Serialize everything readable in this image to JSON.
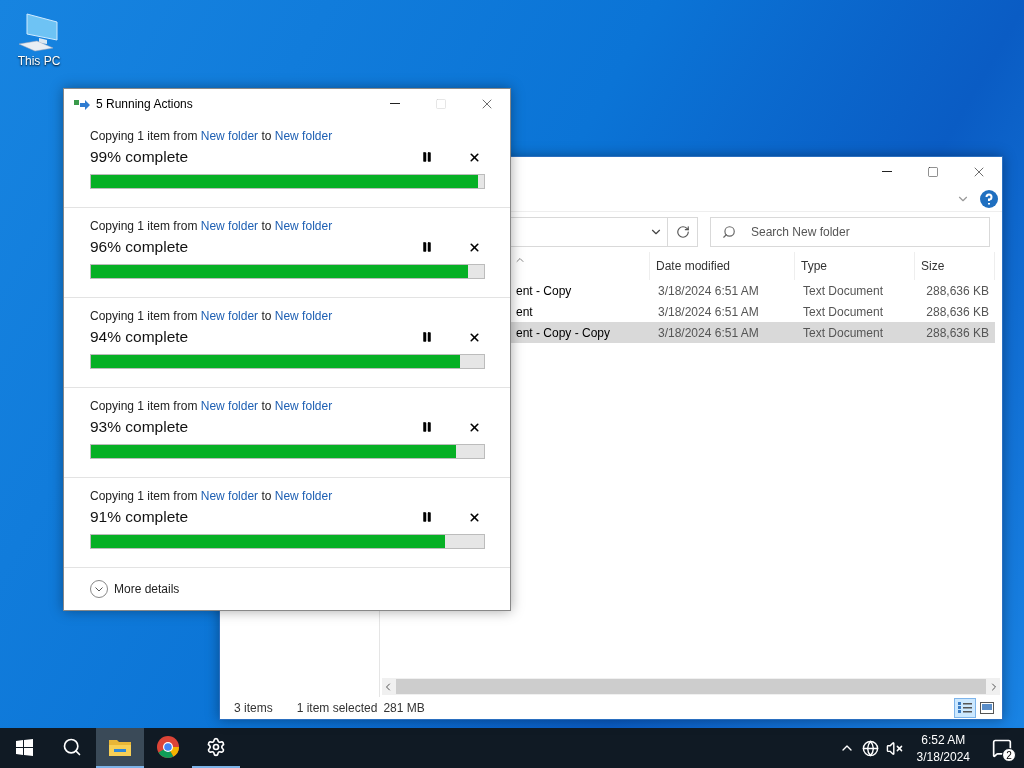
{
  "desktop": {
    "icons": [
      {
        "label": "This PC"
      }
    ]
  },
  "explorer": {
    "search": {
      "placeholder": "Search New folder"
    },
    "columns": [
      {
        "label": "Date modified"
      },
      {
        "label": "Type"
      },
      {
        "label": "Size"
      }
    ],
    "rows": [
      {
        "name": "ent - Copy",
        "date": "3/18/2024 6:51 AM",
        "type": "Text Document",
        "size": "288,636 KB",
        "selected": false
      },
      {
        "name": "ent",
        "date": "3/18/2024 6:51 AM",
        "type": "Text Document",
        "size": "288,636 KB",
        "selected": false
      },
      {
        "name": "ent - Copy - Copy",
        "date": "3/18/2024 6:51 AM",
        "type": "Text Document",
        "size": "288,636 KB",
        "selected": true
      }
    ],
    "status_bar": {
      "items": "3 items",
      "selection": "1 item selected",
      "selection_size": "281 MB"
    },
    "views": [
      {
        "kind": "details",
        "selected": true
      },
      {
        "kind": "thumbnails",
        "selected": false
      }
    ]
  },
  "dialog": {
    "title": "5 Running Actions",
    "operations": [
      {
        "prefix": "Copying 1 item from",
        "source": "New folder",
        "middle": "to",
        "target": "New folder",
        "status": "99% complete",
        "level": 0.985
      },
      {
        "prefix": "Copying 1 item from",
        "source": "New folder",
        "middle": "to",
        "target": "New folder",
        "status": "96% complete",
        "level": 0.96
      },
      {
        "prefix": "Copying 1 item from",
        "source": "New folder",
        "middle": "to",
        "target": "New folder",
        "status": "94% complete",
        "level": 0.94
      },
      {
        "prefix": "Copying 1 item from",
        "source": "New folder",
        "middle": "to",
        "target": "New folder",
        "status": "93% complete",
        "level": 0.93
      },
      {
        "prefix": "Copying 1 item from",
        "source": "New folder",
        "middle": "to",
        "target": "New folder",
        "status": "91% complete",
        "level": 0.902
      }
    ],
    "more_details": "More details"
  },
  "taskbar": {
    "apps": [
      {
        "kind": "explorer",
        "active": true,
        "running": true
      },
      {
        "kind": "chrome",
        "active": false,
        "running": false
      },
      {
        "kind": "settings",
        "active": false,
        "running": true
      }
    ],
    "time": "6:52 AM",
    "date": "3/18/2024",
    "notification_count": "2"
  }
}
